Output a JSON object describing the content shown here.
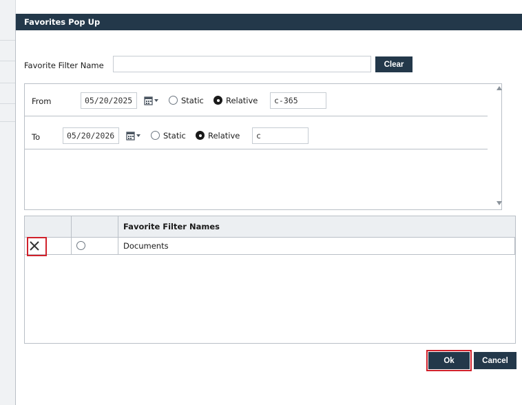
{
  "dialog": {
    "title": "Favorites Pop Up"
  },
  "filter_name": {
    "label": "Favorite Filter Name",
    "value": "",
    "clear_label": "Clear"
  },
  "dates": [
    {
      "label": "From",
      "date": "05/20/2025",
      "static_label": "Static",
      "relative_label": "Relative",
      "selected": "relative",
      "relative_value": "c-365"
    },
    {
      "label": "To",
      "date": "05/20/2026",
      "static_label": "Static",
      "relative_label": "Relative",
      "selected": "relative",
      "relative_value": "c"
    }
  ],
  "favorites_grid": {
    "column_header": "Favorite Filter Names",
    "rows": [
      {
        "name": "Documents",
        "selected": false
      }
    ]
  },
  "footer": {
    "ok_label": "Ok",
    "cancel_label": "Cancel"
  },
  "icons": {
    "calendar": "calendar-icon",
    "dropdown": "caret-down-icon",
    "delete": "close-x-icon",
    "scroll_up": "triangle-up-icon",
    "scroll_down": "triangle-down-icon"
  },
  "colors": {
    "header_bg": "#23384a",
    "button_bg": "#23384a",
    "highlight": "#d0202a"
  }
}
